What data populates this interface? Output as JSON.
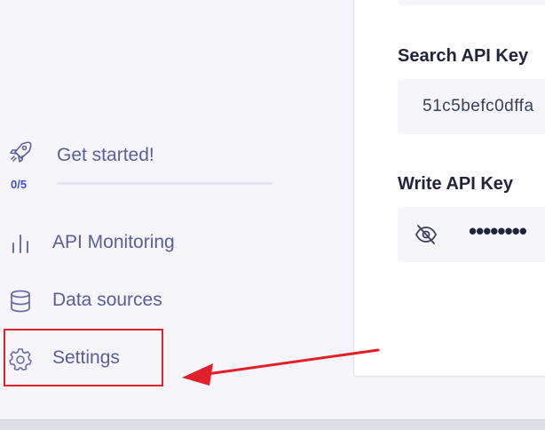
{
  "sidebar": {
    "get_started": {
      "label": "Get started!",
      "progress_text": "0/5",
      "progress_fraction": 0
    },
    "items": [
      {
        "label": "API Monitoring",
        "icon": "bar-chart-icon"
      },
      {
        "label": "Data sources",
        "icon": "database-icon"
      },
      {
        "label": "Settings",
        "icon": "gear-icon"
      }
    ]
  },
  "main": {
    "search_key": {
      "label": "Search API Key",
      "value": "51c5befc0dffa"
    },
    "write_key": {
      "label": "Write API Key",
      "value": "••••••••",
      "toggle_icon": "eye-off-icon"
    }
  },
  "annotation": {
    "color": "#e0202a"
  },
  "colors": {
    "accent": "#3c4fe0",
    "nav_text": "#5a5e9a",
    "heading": "#21243d"
  }
}
